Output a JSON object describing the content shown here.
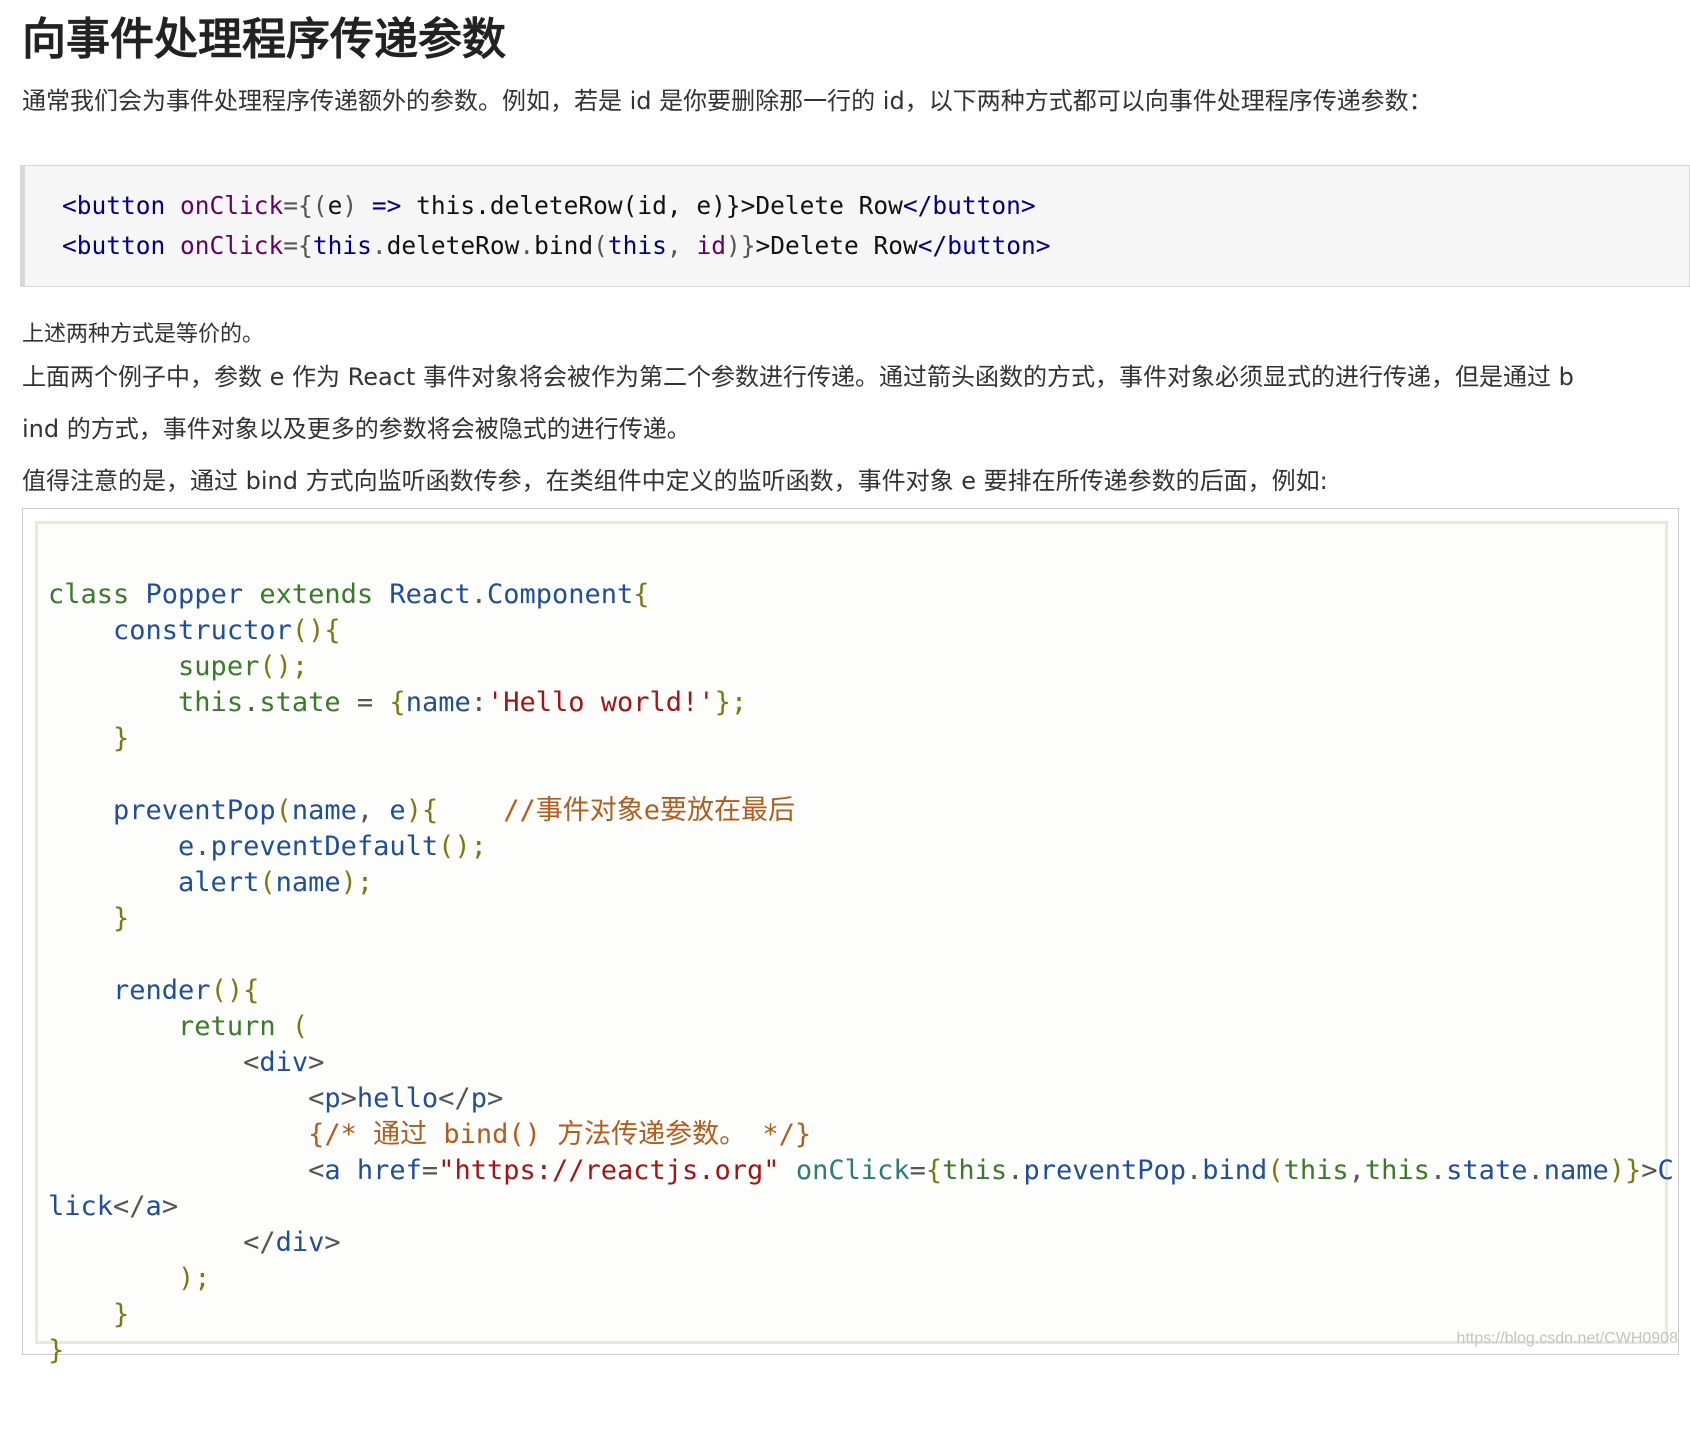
{
  "heading": "向事件处理程序传递参数",
  "intro": "通常我们会为事件处理程序传递额外的参数。例如，若是 id 是你要删除那一行的 id，以下两种方式都可以向事件处理程序传递参数：",
  "code_example_1": {
    "lines": [
      "<button onClick={(e) => this.deleteRow(id, e)}>Delete Row</button>",
      "<button onClick={this.deleteRow.bind(this, id)}>Delete Row</button>"
    ]
  },
  "equivalence_note": "上述两种方式是等价的。",
  "explanation_line1": "上面两个例子中，参数 e 作为 React 事件对象将会被作为第二个参数进行传递。通过箭头函数的方式，事件对象必须显式的进行传递，但是通过 b",
  "explanation_line2": "ind 的方式，事件对象以及更多的参数将会被隐式的进行传递。",
  "note_bind": "值得注意的是，通过 bind 方式向监听函数传参，在类组件中定义的监听函数，事件对象 e 要排在所传递参数的后面，例如:",
  "code_example_2": {
    "lines": [
      "class Popper extends React.Component{",
      "    constructor(){",
      "        super();",
      "        this.state = {name:'Hello world!'};",
      "    }",
      "",
      "    preventPop(name, e){    //事件对象e要放在最后",
      "        e.preventDefault();",
      "        alert(name);",
      "    }",
      "",
      "    render(){",
      "        return (",
      "            <div>",
      "                <p>hello</p>",
      "                {/* 通过 bind() 方法传递参数。 */}",
      "                <a href=\"https://reactjs.org\" onClick={this.preventPop.bind(this,this.state.name)}>C",
      "lick</a>",
      "            </div>",
      "        );",
      "    }",
      "}"
    ]
  },
  "watermark": "https://blog.csdn.net/CWH0908"
}
